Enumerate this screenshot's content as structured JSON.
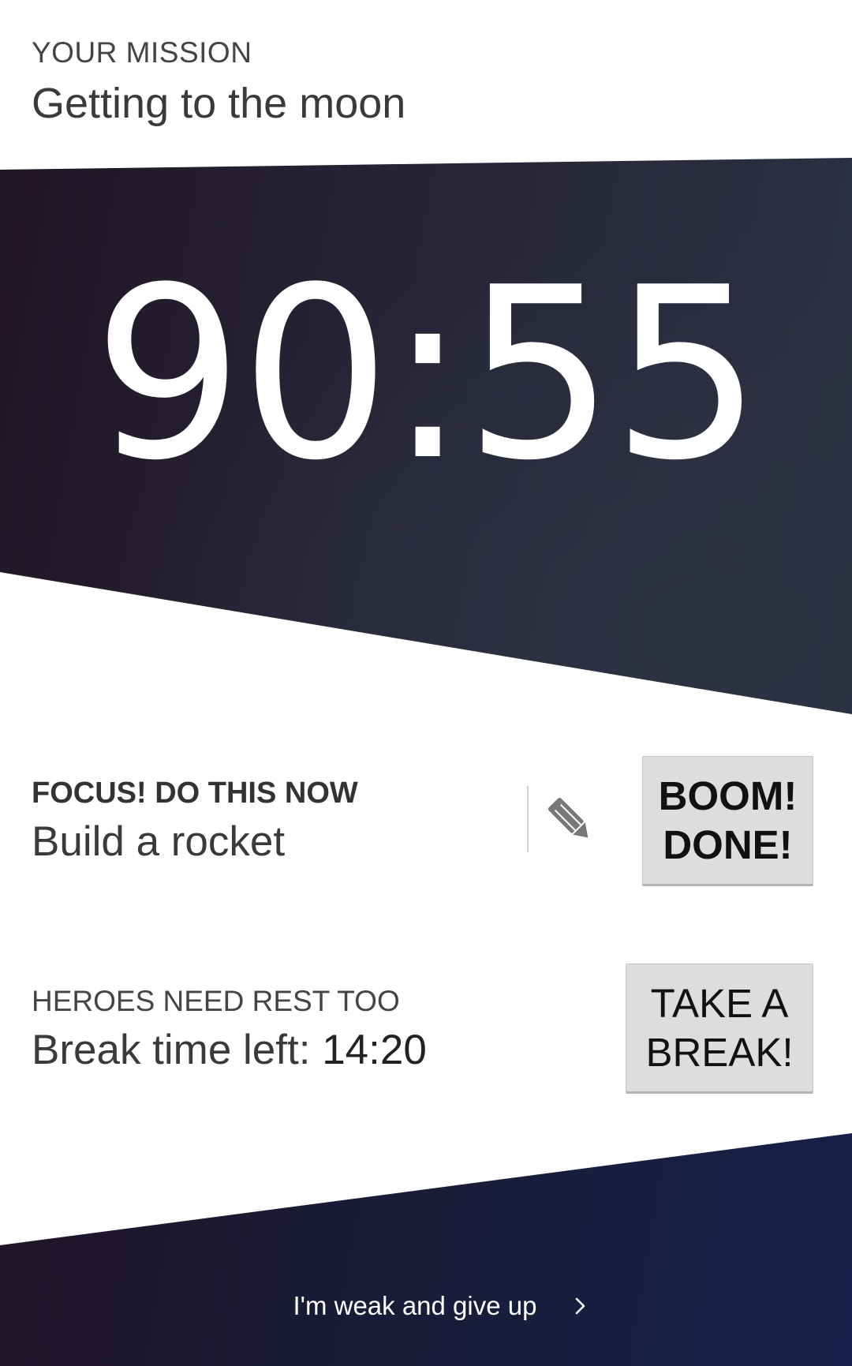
{
  "mission": {
    "label": "YOUR MISSION",
    "title": "Getting to the moon"
  },
  "timer": {
    "value": "90:55"
  },
  "focus": {
    "label": "FOCUS! DO THIS NOW",
    "task": "Build a rocket",
    "edit_icon": "pencil-icon",
    "done_line1": "BOOM!",
    "done_line2": "DONE!"
  },
  "rest": {
    "label": "HEROES NEED REST TOO",
    "prefix": "Break time left:",
    "time": "14:20",
    "break_line1": "TAKE A",
    "break_line2": "BREAK!"
  },
  "give_up": {
    "label": "I'm weak and give up",
    "icon": "chevron-right-icon"
  },
  "colors": {
    "timer_band": "#262336",
    "bottom_band": "#1a1c38",
    "button_bg": "#dddddd",
    "text": "#333333"
  }
}
